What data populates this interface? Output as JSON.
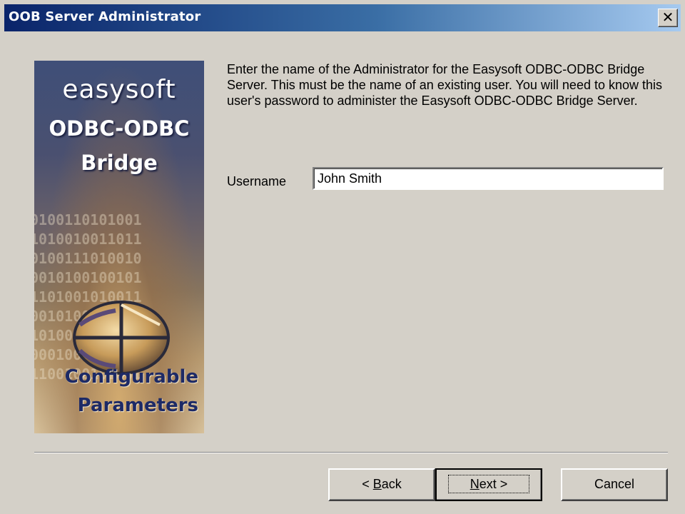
{
  "window": {
    "title": "OOB Server Administrator",
    "close_glyph": "✕"
  },
  "banner": {
    "brand": "easysoft",
    "line1": "ODBC-ODBC",
    "line2": "Bridge",
    "footer1": "Configurable",
    "footer2": "Parameters",
    "binary_text": "0100110101001\n1010010011011\n0100111010010\n0010100100101\n1101001010011\n0010100101010\n1010010010100\n0001000010001\n1100100101001"
  },
  "main": {
    "instructions": "Enter the name of the Administrator for the Easysoft ODBC-ODBC Bridge Server. This must be the name of an existing user. You will need to know this user's password to administer the Easysoft ODBC-ODBC Bridge Server.",
    "username_label": "Username",
    "username_value": "John Smith"
  },
  "buttons": {
    "back_prefix": "< ",
    "back_accel": "B",
    "back_rest": "ack",
    "next_accel": "N",
    "next_rest": "ext >",
    "cancel": "Cancel"
  },
  "icons": {
    "close": "close-icon",
    "logo": "bridge-logo-icon"
  }
}
